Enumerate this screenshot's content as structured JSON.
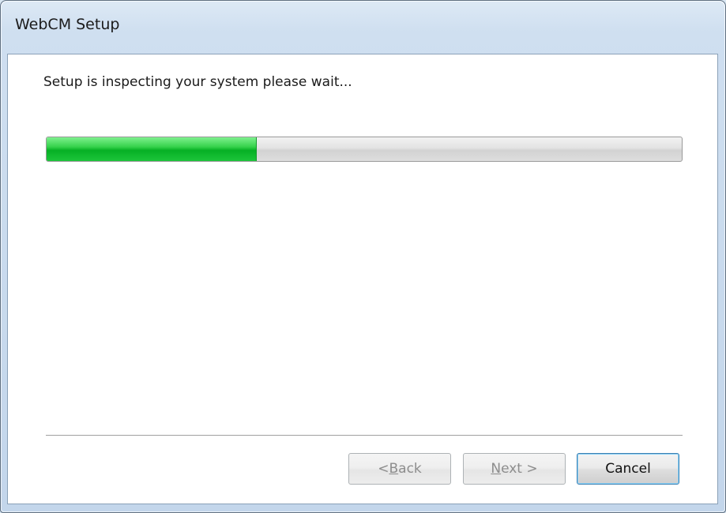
{
  "window": {
    "title": "WebCM Setup"
  },
  "main": {
    "status_message": "Setup is inspecting your system please wait...",
    "progress": 0.33
  },
  "buttons": {
    "back": "< Back",
    "next": "Next >",
    "cancel": "Cancel"
  },
  "colors": {
    "progress_fill": "#06b025",
    "progress_track": "#e0e0e0",
    "titlebar": "#cfdff0"
  }
}
